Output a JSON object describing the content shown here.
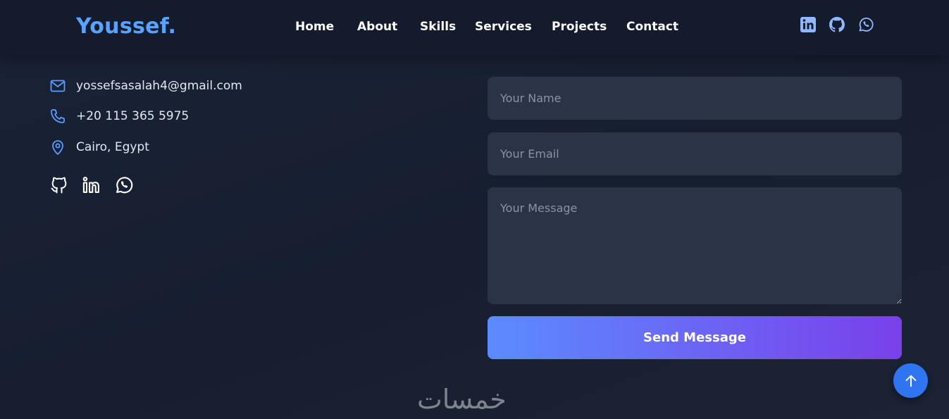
{
  "header": {
    "logo": "Youssef.",
    "nav": [
      "Home",
      "About",
      "Skills",
      "Services",
      "Projects",
      "Contact"
    ],
    "icons": [
      "linkedin-icon",
      "github-icon",
      "whatsapp-icon"
    ]
  },
  "contact": {
    "email": "yossefsasalah4@gmail.com",
    "phone": "+20 115 365 5975",
    "location": "Cairo, Egypt",
    "social_icons": [
      "github-icon",
      "linkedin-icon",
      "whatsapp-icon"
    ]
  },
  "form": {
    "name_placeholder": "Your Name",
    "email_placeholder": "Your Email",
    "message_placeholder": "Your Message",
    "submit_label": "Send Message"
  },
  "watermark": "خمسات",
  "colors": {
    "accent": "#5aa2ff",
    "button_start": "#5b8cff",
    "button_end": "#7a40ea",
    "scroll_top": "#2f74f0"
  }
}
